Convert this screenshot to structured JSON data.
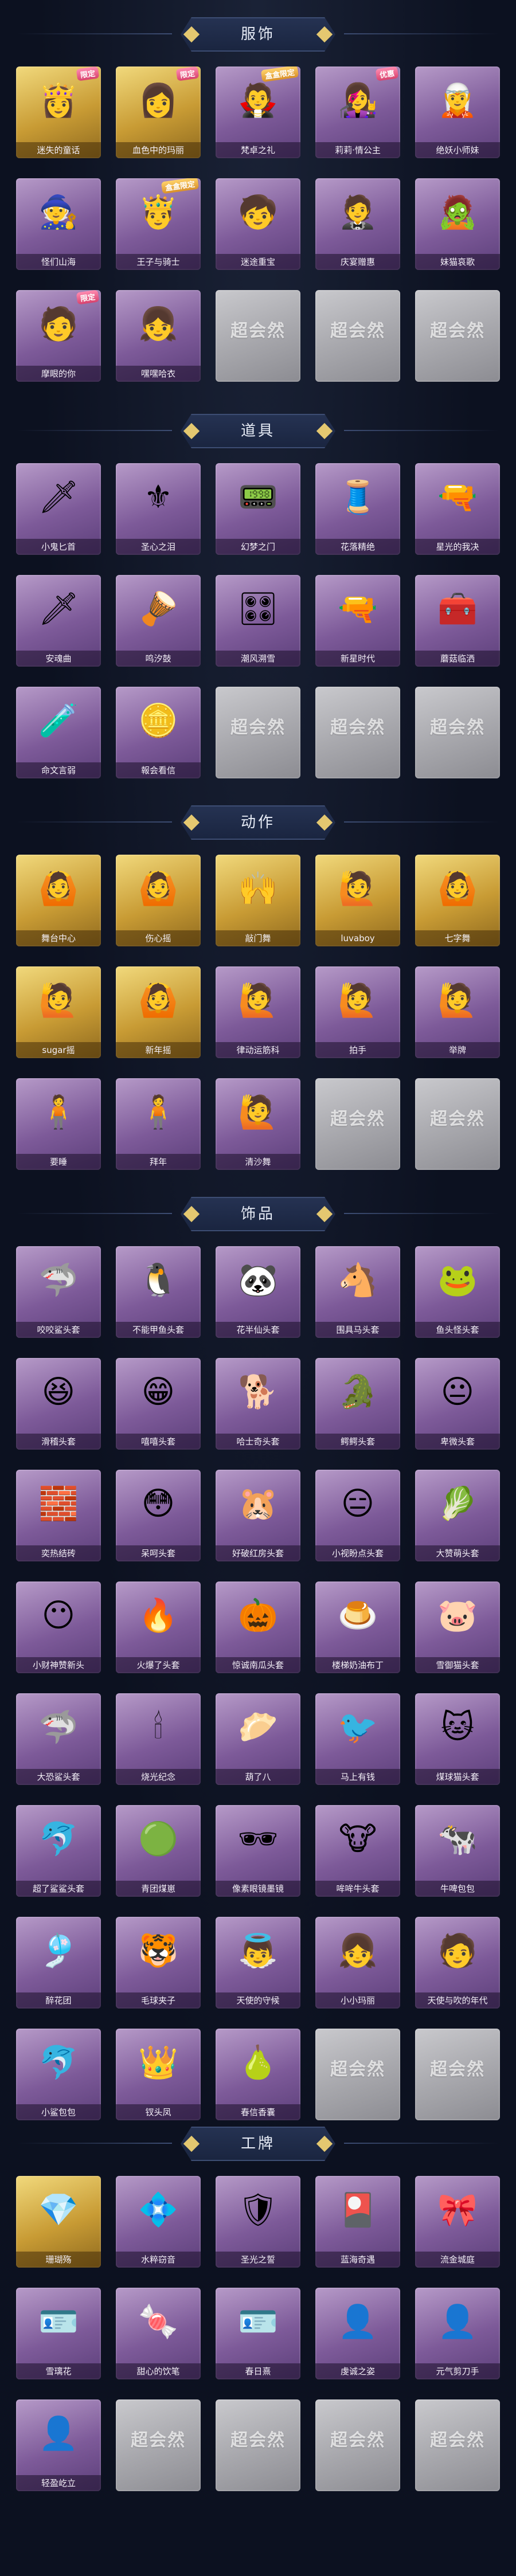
{
  "empty_label": "超会然",
  "sections": [
    {
      "title": "服饰",
      "items": [
        {
          "label": "迷失的童话",
          "icon": "👸",
          "tier": "gold",
          "badge": "限定"
        },
        {
          "label": "血色中的玛丽",
          "icon": "👩",
          "tier": "gold",
          "badge": "限定"
        },
        {
          "label": "梵卓之礼",
          "icon": "🧛",
          "tier": "purple",
          "badge": "盒盒限定"
        },
        {
          "label": "莉莉·情公主",
          "icon": "👩‍🎤",
          "tier": "purple",
          "badge": "优惠"
        },
        {
          "label": "绝妖小师妹",
          "icon": "🧝",
          "tier": "purple"
        },
        {
          "label": "怪们山海",
          "icon": "🧙",
          "tier": "purple"
        },
        {
          "label": "王子与骑士",
          "icon": "🤴",
          "tier": "purple",
          "badge": "盒盒限定"
        },
        {
          "label": "迷途重宝",
          "icon": "🧒",
          "tier": "purple"
        },
        {
          "label": "庆宴赠惠",
          "icon": "🤵",
          "tier": "purple"
        },
        {
          "label": "妹猫哀歌",
          "icon": "🧟",
          "tier": "purple"
        },
        {
          "label": "摩眼的你",
          "icon": "🧑",
          "tier": "purple",
          "badge": "限定"
        },
        {
          "label": "嘿嘿哈衣",
          "icon": "👧",
          "tier": "purple"
        },
        {
          "label": "",
          "icon": "",
          "tier": "empty"
        },
        {
          "label": "",
          "icon": "",
          "tier": "empty"
        },
        {
          "label": "",
          "icon": "",
          "tier": "empty"
        }
      ]
    },
    {
      "title": "道具",
      "items": [
        {
          "label": "小鬼匕首",
          "icon": "🗡",
          "tier": "purple"
        },
        {
          "label": "圣心之泪",
          "icon": "⚜",
          "tier": "purple"
        },
        {
          "label": "幻梦之门",
          "icon": "📟",
          "tier": "purple"
        },
        {
          "label": "花落精绝",
          "icon": "🧵",
          "tier": "purple"
        },
        {
          "label": "星光的我决",
          "icon": "🔫",
          "tier": "purple"
        },
        {
          "label": "安魂曲",
          "icon": "🗡",
          "tier": "purple"
        },
        {
          "label": "鸣汐鼓",
          "icon": "🪘",
          "tier": "purple"
        },
        {
          "label": "潮风溯雪",
          "icon": "🎛",
          "tier": "purple"
        },
        {
          "label": "新星时代",
          "icon": "🔫",
          "tier": "purple"
        },
        {
          "label": "蘑菇临洒",
          "icon": "🧰",
          "tier": "purple"
        },
        {
          "label": "命文言弱",
          "icon": "🧪",
          "tier": "purple"
        },
        {
          "label": "報会看信",
          "icon": "🪙",
          "tier": "purple"
        },
        {
          "label": "",
          "icon": "",
          "tier": "empty"
        },
        {
          "label": "",
          "icon": "",
          "tier": "empty"
        },
        {
          "label": "",
          "icon": "",
          "tier": "empty"
        }
      ]
    },
    {
      "title": "动作",
      "items": [
        {
          "label": "舞台中心",
          "icon": "🙆",
          "tier": "gold"
        },
        {
          "label": "伤心摇",
          "icon": "🙆",
          "tier": "gold"
        },
        {
          "label": "敲门舞",
          "icon": "🙌",
          "tier": "gold"
        },
        {
          "label": "luvaboy",
          "icon": "🙋",
          "tier": "gold"
        },
        {
          "label": "七字舞",
          "icon": "🙆",
          "tier": "gold"
        },
        {
          "label": "sugar摇",
          "icon": "🙋",
          "tier": "gold"
        },
        {
          "label": "新年摇",
          "icon": "🙆",
          "tier": "gold"
        },
        {
          "label": "律动运筋科",
          "icon": "🙋",
          "tier": "purple"
        },
        {
          "label": "拍手",
          "icon": "🙋",
          "tier": "purple"
        },
        {
          "label": "举牌",
          "icon": "🙋",
          "tier": "purple"
        },
        {
          "label": "要睡",
          "icon": "🧍",
          "tier": "purple"
        },
        {
          "label": "拜年",
          "icon": "🧍",
          "tier": "purple"
        },
        {
          "label": "清沙舞",
          "icon": "🙋",
          "tier": "purple"
        },
        {
          "label": "",
          "icon": "",
          "tier": "empty"
        },
        {
          "label": "",
          "icon": "",
          "tier": "empty"
        }
      ]
    },
    {
      "title": "饰品",
      "items": [
        {
          "label": "咬咬鲨头套",
          "icon": "🦈",
          "tier": "purple"
        },
        {
          "label": "不能甲鱼头套",
          "icon": "🐧",
          "tier": "purple"
        },
        {
          "label": "花半仙头套",
          "icon": "🐼",
          "tier": "purple"
        },
        {
          "label": "围具马头套",
          "icon": "🐴",
          "tier": "purple"
        },
        {
          "label": "鱼头怪头套",
          "icon": "🐸",
          "tier": "purple"
        },
        {
          "label": "滑稽头套",
          "icon": "😆",
          "tier": "purple"
        },
        {
          "label": "嘻嘻头套",
          "icon": "😁",
          "tier": "purple"
        },
        {
          "label": "哈士奇头套",
          "icon": "🐕",
          "tier": "purple"
        },
        {
          "label": "鳄鳄头套",
          "icon": "🐊",
          "tier": "purple"
        },
        {
          "label": "卑微头套",
          "icon": "😐",
          "tier": "purple"
        },
        {
          "label": "奕热结砖",
          "icon": "🧱",
          "tier": "purple"
        },
        {
          "label": "呆呵头套",
          "icon": "😳",
          "tier": "purple"
        },
        {
          "label": "好破红房头套",
          "icon": "🐹",
          "tier": "purple"
        },
        {
          "label": "小视盼点头套",
          "icon": "😑",
          "tier": "purple"
        },
        {
          "label": "大赞萌头套",
          "icon": "🥬",
          "tier": "purple"
        },
        {
          "label": "小财神赞新头",
          "icon": "😶",
          "tier": "purple"
        },
        {
          "label": "火爆了头套",
          "icon": "🔥",
          "tier": "purple"
        },
        {
          "label": "惊诚南瓜头套",
          "icon": "🎃",
          "tier": "purple"
        },
        {
          "label": "楼梯奶油布丁",
          "icon": "🍮",
          "tier": "purple"
        },
        {
          "label": "雪御猫头套",
          "icon": "🐷",
          "tier": "purple"
        },
        {
          "label": "大恐鲨头套",
          "icon": "🦈",
          "tier": "purple"
        },
        {
          "label": "烧光纪念",
          "icon": "🕯",
          "tier": "purple"
        },
        {
          "label": "葫了八",
          "icon": "🥟",
          "tier": "purple"
        },
        {
          "label": "马上有钱",
          "icon": "🐦",
          "tier": "purple"
        },
        {
          "label": "煤球猫头套",
          "icon": "🐱",
          "tier": "purple"
        },
        {
          "label": "超了鲨鲨头套",
          "icon": "🐬",
          "tier": "purple"
        },
        {
          "label": "青团煤崽",
          "icon": "🟢",
          "tier": "purple"
        },
        {
          "label": "像素眼镜墨镜",
          "icon": "🕶",
          "tier": "purple"
        },
        {
          "label": "哞哞牛头套",
          "icon": "🐮",
          "tier": "purple"
        },
        {
          "label": "牛啤包包",
          "icon": "🐄",
          "tier": "purple"
        },
        {
          "label": "醉花团",
          "icon": "🎐",
          "tier": "purple"
        },
        {
          "label": "毛球夹子",
          "icon": "🐯",
          "tier": "purple"
        },
        {
          "label": "天使的守候",
          "icon": "👼",
          "tier": "purple"
        },
        {
          "label": "小小玛丽",
          "icon": "👧",
          "tier": "purple"
        },
        {
          "label": "天使与吹的年代",
          "icon": "🧑",
          "tier": "purple"
        },
        {
          "label": "小鲨包包",
          "icon": "🐬",
          "tier": "purple"
        },
        {
          "label": "钗头凤",
          "icon": "👑",
          "tier": "purple"
        },
        {
          "label": "春信香囊",
          "icon": "🍐",
          "tier": "purple"
        },
        {
          "label": "",
          "icon": "",
          "tier": "empty"
        },
        {
          "label": "",
          "icon": "",
          "tier": "empty"
        }
      ]
    },
    {
      "title": "工牌",
      "items": [
        {
          "label": "珊瑚殇",
          "icon": "💎",
          "tier": "gold"
        },
        {
          "label": "水粹窃音",
          "icon": "💠",
          "tier": "purple"
        },
        {
          "label": "圣光之誓",
          "icon": "🛡",
          "tier": "purple"
        },
        {
          "label": "蓝海奇遇",
          "icon": "🎴",
          "tier": "purple"
        },
        {
          "label": "流金城庭",
          "icon": "🎀",
          "tier": "purple"
        },
        {
          "label": "雪璃花",
          "icon": "🪪",
          "tier": "purple"
        },
        {
          "label": "甜心的饮笔",
          "icon": "🍬",
          "tier": "purple"
        },
        {
          "label": "春日熹",
          "icon": "🪪",
          "tier": "purple"
        },
        {
          "label": "虔诚之姿",
          "icon": "👤",
          "tier": "purple"
        },
        {
          "label": "元气剪刀手",
          "icon": "👤",
          "tier": "purple"
        },
        {
          "label": "轻盈屹立",
          "icon": "👤",
          "tier": "purple"
        },
        {
          "label": "",
          "icon": "",
          "tier": "empty"
        },
        {
          "label": "",
          "icon": "",
          "tier": "empty"
        },
        {
          "label": "",
          "icon": "",
          "tier": "empty"
        },
        {
          "label": "",
          "icon": "",
          "tier": "empty"
        }
      ]
    }
  ]
}
